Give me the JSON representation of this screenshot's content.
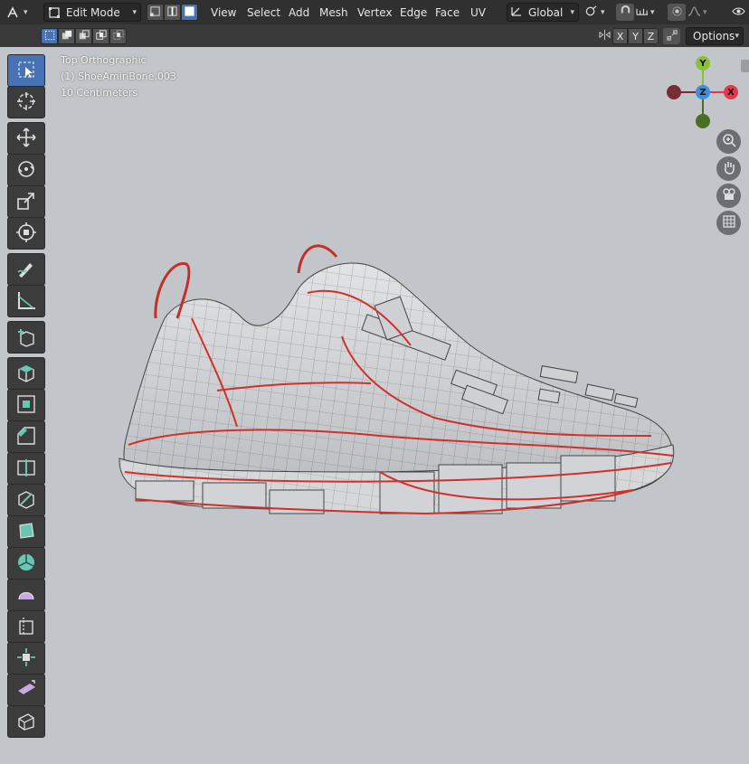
{
  "header": {
    "editor_icon": "editor-type-icon",
    "mode_label": "Edit Mode",
    "menus": [
      "View",
      "Select",
      "Add",
      "Mesh",
      "Vertex",
      "Edge",
      "Face",
      "UV"
    ],
    "orientation_label": "Global",
    "options_label": "Options",
    "axis_x": "X",
    "axis_y": "Y",
    "axis_z": "Z"
  },
  "viewport": {
    "view_name": "Top Orthographic",
    "object_name": "(1) ShoeAmiriBone.003",
    "scale_label": "10 Centimeters"
  },
  "gizmo": {
    "x_label": "X",
    "y_label": "Y",
    "z_label": "Z",
    "colors": {
      "x": "#e8364a",
      "y": "#8bc135",
      "z": "#3a8fe0",
      "neg_x": "#7a2c33",
      "neg_y": "#4a6e22"
    }
  },
  "tools": [
    "select-box-icon",
    "cursor-icon",
    "move-icon",
    "rotate-icon",
    "scale-icon",
    "transform-icon",
    "annotate-icon",
    "measure-icon",
    "add-cube-icon",
    "extrude-icon",
    "inset-icon",
    "bevel-icon",
    "loop-cut-icon",
    "knife-icon",
    "poly-build-icon",
    "spin-icon",
    "smooth-icon",
    "edge-slide-icon",
    "shrink-fatten-icon",
    "shear-icon",
    "rip-icon"
  ],
  "colors": {
    "accent": "#4772b3",
    "viewport_bg": "#c2c6ca",
    "edge_seam": "#d0302a"
  }
}
